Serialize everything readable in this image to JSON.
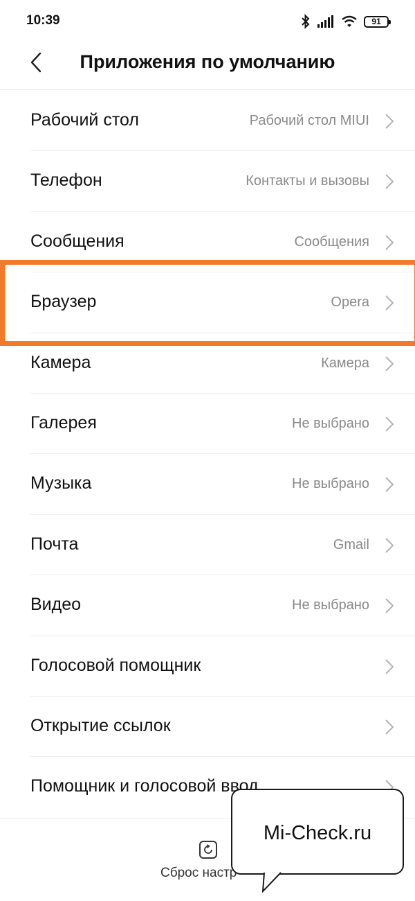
{
  "status_bar": {
    "time": "10:39",
    "battery": "91",
    "icons": [
      "bluetooth-icon",
      "signal-icon",
      "wifi-icon",
      "battery-icon"
    ]
  },
  "header": {
    "title": "Приложения по умолчанию",
    "back_icon": "chevron-left-icon"
  },
  "items": [
    {
      "label": "Рабочий стол",
      "value": "Рабочий стол MIUI"
    },
    {
      "label": "Телефон",
      "value": "Контакты и вызовы"
    },
    {
      "label": "Сообщения",
      "value": "Сообщения"
    },
    {
      "label": "Браузер",
      "value": "Opera"
    },
    {
      "label": "Камера",
      "value": "Камера"
    },
    {
      "label": "Галерея",
      "value": "Не выбрано"
    },
    {
      "label": "Музыка",
      "value": "Не выбрано"
    },
    {
      "label": "Почта",
      "value": "Gmail"
    },
    {
      "label": "Видео",
      "value": "Не выбрано"
    },
    {
      "label": "Голосовой помощник",
      "value": ""
    },
    {
      "label": "Открытие ссылок",
      "value": ""
    },
    {
      "label": "Помощник и голосовой ввод",
      "value": ""
    }
  ],
  "highlighted_item": "Браузер",
  "bottom_bar": {
    "reset_label": "Сброс настр",
    "reset_icon": "reset-icon"
  },
  "watermark": {
    "text": "Mi-Check.ru"
  },
  "colors": {
    "highlight": "#f27a2a",
    "value_text": "#8a8a8a",
    "divider": "#ececec"
  }
}
